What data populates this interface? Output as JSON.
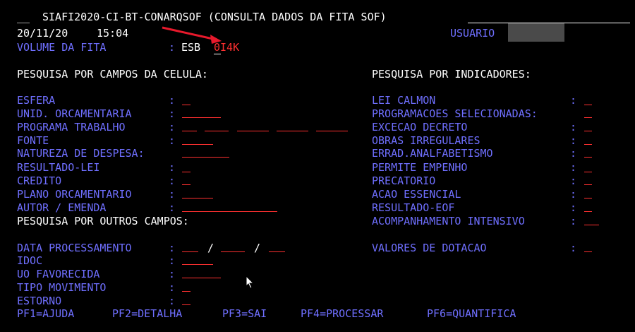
{
  "header": {
    "prefix": "__",
    "title": "SIAFI2020-CI-BT-CONARQSOF (CONSULTA DADOS DA FITA SOF)",
    "date": "20/11/20",
    "time": "15:04",
    "user_label": "USUARIO",
    "volume_label": "VOLUME DA FITA",
    "volume_colon": ":",
    "volume_prefix": "ESB",
    "volume_code": "0I4K"
  },
  "left_section": {
    "title": "PESQUISA POR CAMPOS DA CELULA:",
    "fields": [
      {
        "label": "ESFERA",
        "colon": ":"
      },
      {
        "label": "UNID. ORCAMENTARIA",
        "colon": ":"
      },
      {
        "label": "PROGRAMA TRABALHO",
        "colon": ":"
      },
      {
        "label": "FONTE",
        "colon": ":"
      },
      {
        "label": "NATUREZA DE DESPESA:",
        "colon": ""
      },
      {
        "label": "RESULTADO-LEI",
        "colon": ":"
      },
      {
        "label": "CREDITO",
        "colon": ":"
      },
      {
        "label": "PLANO ORCAMENTARIO",
        "colon": ":"
      },
      {
        "label": "AUTOR / EMENDA",
        "colon": ":"
      }
    ]
  },
  "right_section": {
    "title": "PESQUISA POR INDICADORES:",
    "fields": [
      {
        "label": "LEI CALMON",
        "colon": ":"
      },
      {
        "label": "PROGRAMACOES SELECIONADAS:",
        "colon": ""
      },
      {
        "label": "EXCECAO DECRETO",
        "colon": ":"
      },
      {
        "label": "OBRAS IRREGULARES",
        "colon": ":"
      },
      {
        "label": "ERRAD.ANALFABETISMO",
        "colon": ":"
      },
      {
        "label": "PERMITE EMPENHO",
        "colon": ":"
      },
      {
        "label": "PRECATORIO",
        "colon": ":"
      },
      {
        "label": "ACAO ESSENCIAL",
        "colon": ":"
      },
      {
        "label": "RESULTADO-EOF",
        "colon": ":"
      },
      {
        "label": "ACOMPANHAMENTO INTENSIVO",
        "colon": ":"
      }
    ],
    "valores_label": "VALORES DE DOTACAO",
    "valores_colon": ":"
  },
  "other_section": {
    "title": "PESQUISA POR OUTROS CAMPOS:",
    "fields": [
      {
        "label": "DATA PROCESSAMENTO",
        "colon": ":"
      },
      {
        "label": "IDOC",
        "colon": ":"
      },
      {
        "label": "UO FAVORECIDA",
        "colon": ":"
      },
      {
        "label": "TIPO MOVIMENTO",
        "colon": ":"
      },
      {
        "label": "ESTORNO",
        "colon": ":"
      }
    ],
    "date_sep": "/"
  },
  "function_keys": [
    "PF1=AJUDA",
    "PF2=DETALHA",
    "PF3=SAI",
    "PF4=PROCESSAR",
    "PF6=QUANTIFICA"
  ],
  "colors": {
    "background": "#000000",
    "label": "#6f6fff",
    "text": "#ffffff",
    "input": "#ff3030"
  },
  "icons": [
    "red-arrow-annotation",
    "mouse-cursor-icon"
  ]
}
